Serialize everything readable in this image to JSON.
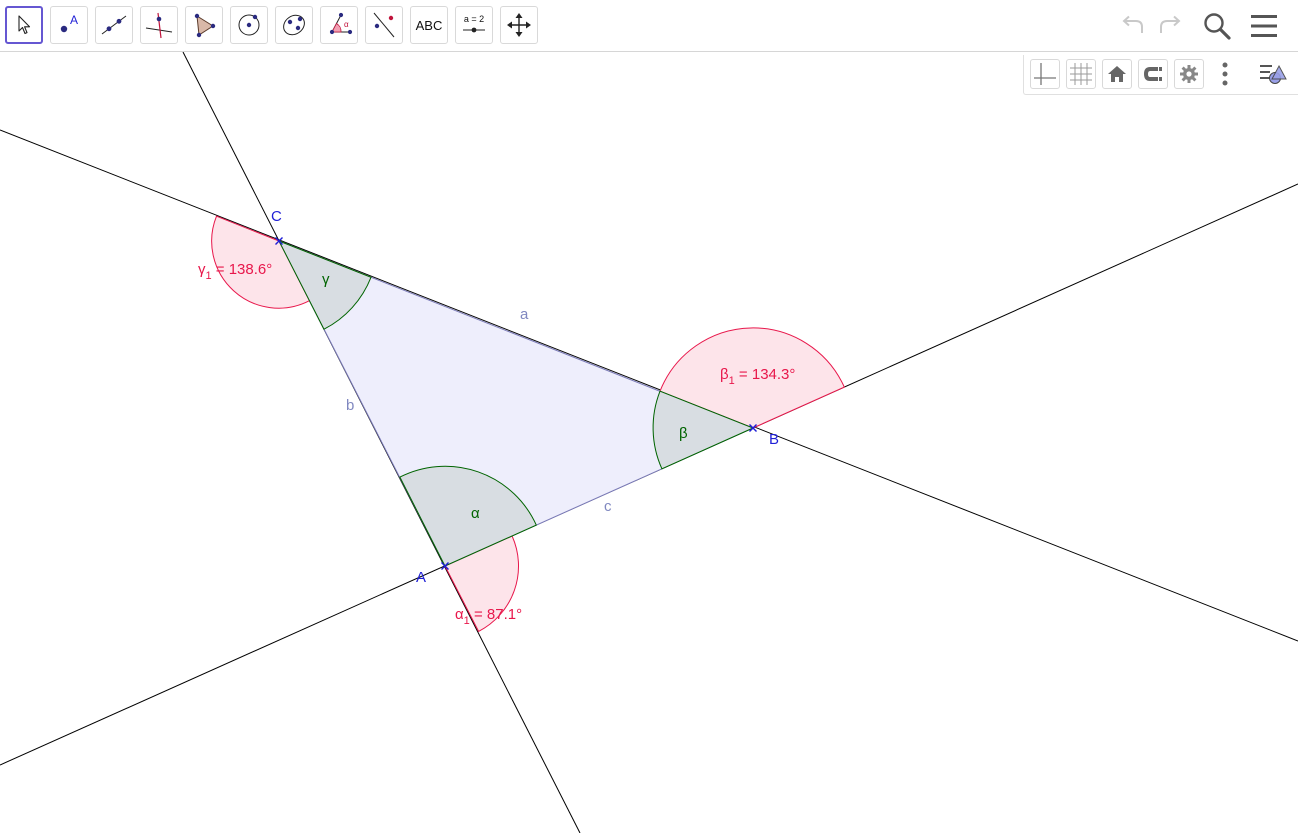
{
  "toolbar": {
    "tools": [
      {
        "name": "move"
      },
      {
        "name": "point",
        "label": "A"
      },
      {
        "name": "line"
      },
      {
        "name": "perpendicular-line"
      },
      {
        "name": "polygon"
      },
      {
        "name": "circle-center-point"
      },
      {
        "name": "ellipse"
      },
      {
        "name": "angle",
        "label": "α"
      },
      {
        "name": "reflect-about-line"
      },
      {
        "name": "text",
        "label": "ABC"
      },
      {
        "name": "slider",
        "label": "a = 2"
      },
      {
        "name": "move-graphics-view"
      }
    ],
    "right": [
      "undo",
      "redo",
      "search",
      "main-menu"
    ]
  },
  "view_bar": [
    "axes",
    "grid",
    "standard-view",
    "point-capturing",
    "graphics-settings",
    "more",
    "style-bar-toggle"
  ],
  "colors": {
    "triangle_fill": "#eeeefc",
    "triangle_stroke": "#7a7ab8",
    "interior_angle": "#006400",
    "interior_fill": "#d8dde2",
    "exterior_angle": "#e8174b",
    "exterior_fill": "#fde4ea",
    "point": "#1f1fd6",
    "line": "#000000",
    "accent": "#6557d2"
  },
  "geometry": {
    "points": [
      {
        "label": "A"
      },
      {
        "label": "B"
      },
      {
        "label": "C"
      }
    ],
    "segments": [
      {
        "label": "a"
      },
      {
        "label": "b"
      },
      {
        "label": "c"
      }
    ],
    "interior_angles": [
      {
        "label": "α"
      },
      {
        "label": "β"
      },
      {
        "label": "γ"
      }
    ],
    "exterior_angles": [
      {
        "name": "α",
        "sub": "1",
        "value": " = 87.1°"
      },
      {
        "name": "β",
        "sub": "1",
        "value": " = 134.3°"
      },
      {
        "name": "γ",
        "sub": "1",
        "value": " = 138.6°"
      }
    ]
  }
}
